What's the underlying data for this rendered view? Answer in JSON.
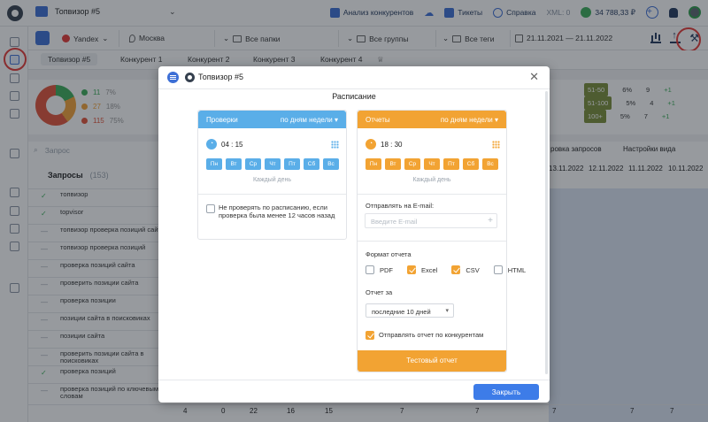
{
  "topbar": {
    "project": "Топвизор #5",
    "competitors_link": "Анализ конкурентов",
    "tickets_link": "Тикеты",
    "help_link": "Справка",
    "xml": "XML: 0",
    "balance": "34 788,33 ₽"
  },
  "toolbar": {
    "engine": "Yandex",
    "region": "Москва",
    "folders": "Все папки",
    "groups": "Все группы",
    "tags": "Все теги",
    "dates": "21.11.2021 — 21.11.2022"
  },
  "tabs": [
    "Топвизор #5",
    "Конкурент 1",
    "Конкурент 2",
    "Конкурент 3",
    "Конкурент 4"
  ],
  "stats": {
    "rows": [
      {
        "count": "11",
        "pct": "7%",
        "color": "#3cae5a"
      },
      {
        "count": "27",
        "pct": "18%",
        "color": "#f4a338"
      },
      {
        "count": "115",
        "pct": "75%",
        "color": "#e2533a"
      }
    ],
    "right_rows": [
      {
        "range": "51-50",
        "pct": "6%",
        "n": "9",
        "d": "+1"
      },
      {
        "range": "51-100",
        "pct": "5%",
        "n": "4",
        "d": "+1"
      },
      {
        "range": "100+",
        "pct": "5%",
        "n": "7",
        "d": "+1"
      }
    ]
  },
  "queries": {
    "search_placeholder": "Запрос",
    "title": "Запросы",
    "count": "(153)",
    "rows": [
      {
        "text": "топвизор",
        "ok": true
      },
      {
        "text": "topvisor",
        "ok": true
      },
      {
        "text": "топвизор проверка позиций сайта",
        "ok": false
      },
      {
        "text": "топвизор проверка позиций",
        "ok": false
      },
      {
        "text": "проверка позиций сайта",
        "ok": false
      },
      {
        "text": "проверить позиции сайта",
        "ok": false
      },
      {
        "text": "проверка позиции",
        "ok": false
      },
      {
        "text": "позиции сайта в поисковиках",
        "ok": false
      },
      {
        "text": "позиции сайта",
        "ok": false
      },
      {
        "text": "проверить позиции сайта в поисковиках",
        "ok": false
      },
      {
        "text": "проверка позиций",
        "ok": true
      },
      {
        "text": "проверка позиций по ключевым словам",
        "ok": false
      }
    ]
  },
  "right_panel": {
    "links": [
      "ровка запросов",
      "Настройки вида"
    ],
    "dates": [
      "13.11.2022",
      "12.11.2022",
      "11.11.2022",
      "10.11.2022"
    ],
    "last_row": [
      "4",
      "0",
      "22",
      "16",
      "15",
      "7",
      "7",
      "7",
      "7",
      "7"
    ]
  },
  "modal": {
    "title": "Топвизор #5",
    "subtitle": "Расписание",
    "close_button": "Закрыть",
    "checks": {
      "header": "Проверки",
      "mode": "по дням недели",
      "time": "04 : 15",
      "days": [
        "Пн",
        "Вт",
        "Ср",
        "Чт",
        "Пт",
        "Сб",
        "Вс"
      ],
      "every": "Каждый день",
      "option": "Не проверять по расписанию, если проверка была менее 12 часов назад"
    },
    "reports": {
      "header": "Отчеты",
      "mode": "по дням недели",
      "time": "18 : 30",
      "days": [
        "Пн",
        "Вт",
        "Ср",
        "Чт",
        "Пт",
        "Сб",
        "Вс"
      ],
      "every": "Каждый день",
      "email_label": "Отправлять на E-mail:",
      "email_placeholder": "Введите E-mail",
      "format_label": "Формат отчета",
      "formats": [
        {
          "name": "PDF",
          "checked": false
        },
        {
          "name": "Excel",
          "checked": true
        },
        {
          "name": "CSV",
          "checked": true
        },
        {
          "name": "HTML",
          "checked": false
        }
      ],
      "period_label": "Отчет за",
      "period_value": "последние 10 дней",
      "competitors_option": "Отправлять отчет по конкурентам",
      "test_button": "Тестовый отчет"
    },
    "colors": {
      "checks": "#5aaee8",
      "reports": "#f2a333"
    }
  }
}
